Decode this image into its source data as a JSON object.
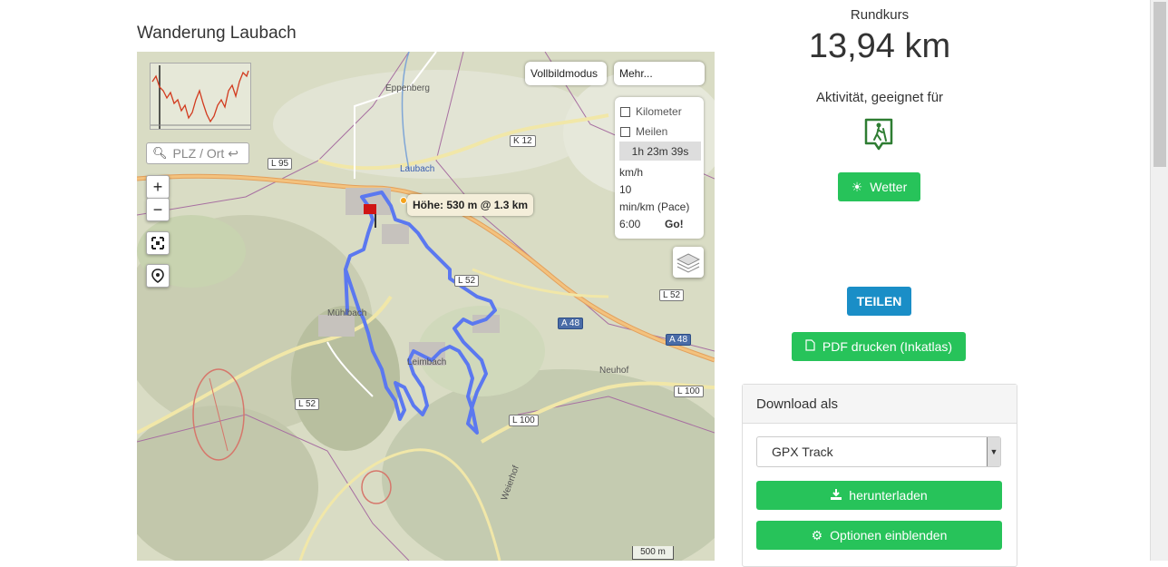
{
  "page": {
    "title": "Wanderung Laubach"
  },
  "map": {
    "fullscreen_label": "Vollbildmodus",
    "more_label": "Mehr...",
    "search_placeholder": "PLZ / Ort ↩",
    "zoom_in": "+",
    "zoom_out": "−",
    "options": {
      "kilometer": "Kilometer",
      "meilen": "Meilen",
      "duration": "1h 23m 39s",
      "speed_label": "km/h",
      "speed_value": "10",
      "pace_label": "min/km (Pace)",
      "pace_value": "6:00",
      "go": "Go!"
    },
    "tooltip": "Höhe: 530 m @ 1.3 km",
    "scale": "500 m",
    "places": [
      "Eppenberg",
      "Laubach",
      "Neuhof",
      "Weierhof",
      "Leimbach",
      "Mühlbach"
    ],
    "roads": [
      "L 95",
      "K 12",
      "L 52",
      "L 52",
      "A 48",
      "A 48",
      "L 100",
      "L 100",
      "L 52"
    ]
  },
  "summary": {
    "type_label": "Rundkurs",
    "distance": "13,94 km",
    "activity_label": "Aktivität, geeignet für",
    "activity_icon": "hiking-icon",
    "weather_button": "Wetter",
    "share_button": "TEILEN",
    "pdf_button": "PDF drucken (Inkatlas)"
  },
  "download": {
    "heading": "Download als",
    "format_selected": "GPX Track",
    "download_button": "herunterladen",
    "options_button": "Optionen einblenden"
  },
  "colors": {
    "green": "#27c35a",
    "blue": "#1a8ec7",
    "track": "#5b78f0"
  }
}
